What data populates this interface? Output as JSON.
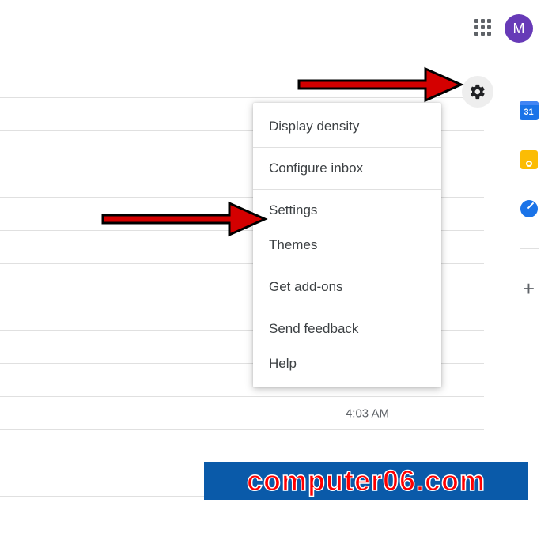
{
  "header": {
    "avatar_initial": "M"
  },
  "calendar_day": "31",
  "menu": {
    "display_density": "Display density",
    "configure_inbox": "Configure inbox",
    "settings": "Settings",
    "themes": "Themes",
    "get_addons": "Get add-ons",
    "send_feedback": "Send feedback",
    "help": "Help"
  },
  "mail_times": {
    "t0": "4:03 AM"
  },
  "watermark": "computer06.com",
  "plus_symbol": "+"
}
